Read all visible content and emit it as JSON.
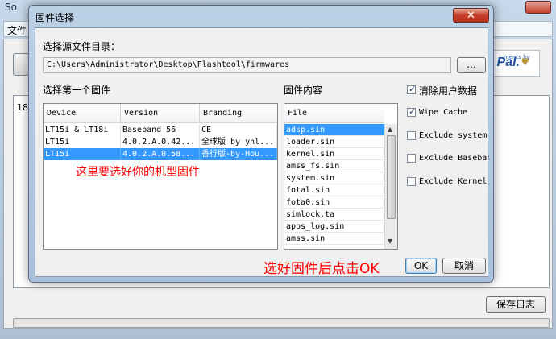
{
  "background_app": {
    "title": "So",
    "menu_file": "文件",
    "log_prefix": "18/",
    "save_log_label": "保存日志",
    "paypal_small": "ments by",
    "paypal_text": "Pal."
  },
  "dialog": {
    "title": "固件选择",
    "close_glyph": "✕",
    "source_dir_label": "选择源文件目录：",
    "source_dir_value": "C:\\Users\\Administrator\\Desktop\\Flashtool\\firmwares",
    "browse_label": "...",
    "firmware_label": "选择第一个固件",
    "content_label": "固件内容",
    "firmware_table": {
      "headers": [
        "Device",
        "Version",
        "Branding"
      ],
      "rows": [
        {
          "device": "LT15i & LT18i",
          "version": "Baseband 56",
          "branding": "CE",
          "selected": false
        },
        {
          "device": "LT15i",
          "version": "4.0.2.A.0.42...",
          "branding": "全球版 by ynl...",
          "selected": false
        },
        {
          "device": "LT15i",
          "version": "4.0.2.A.0.58...",
          "branding": "香行版-by-Hou...",
          "selected": true
        }
      ]
    },
    "file_table": {
      "header": "File",
      "files": [
        "adsp.sin",
        "loader.sin",
        "kernel.sin",
        "amss_fs.sin",
        "system.sin",
        "fotal.sin",
        "fota0.sin",
        "simlock.ta",
        "apps_log.sin",
        "amss.sin"
      ],
      "selected_index": 0
    },
    "options": [
      {
        "label": "清除用户数据",
        "checked": true
      },
      {
        "label": "Wipe Cache",
        "checked": true
      },
      {
        "label": "Exclude system",
        "checked": false
      },
      {
        "label": "Exclude Baseband",
        "checked": false
      },
      {
        "label": "Exclude Kernel",
        "checked": false
      }
    ],
    "annotation_select": "这里要选好你的机型固件",
    "annotation_ok": "选好固件后点击OK",
    "ok_label": "OK",
    "cancel_label": "取消"
  },
  "colors": {
    "selection": "#3399ff",
    "annotation": "#ff0000"
  }
}
